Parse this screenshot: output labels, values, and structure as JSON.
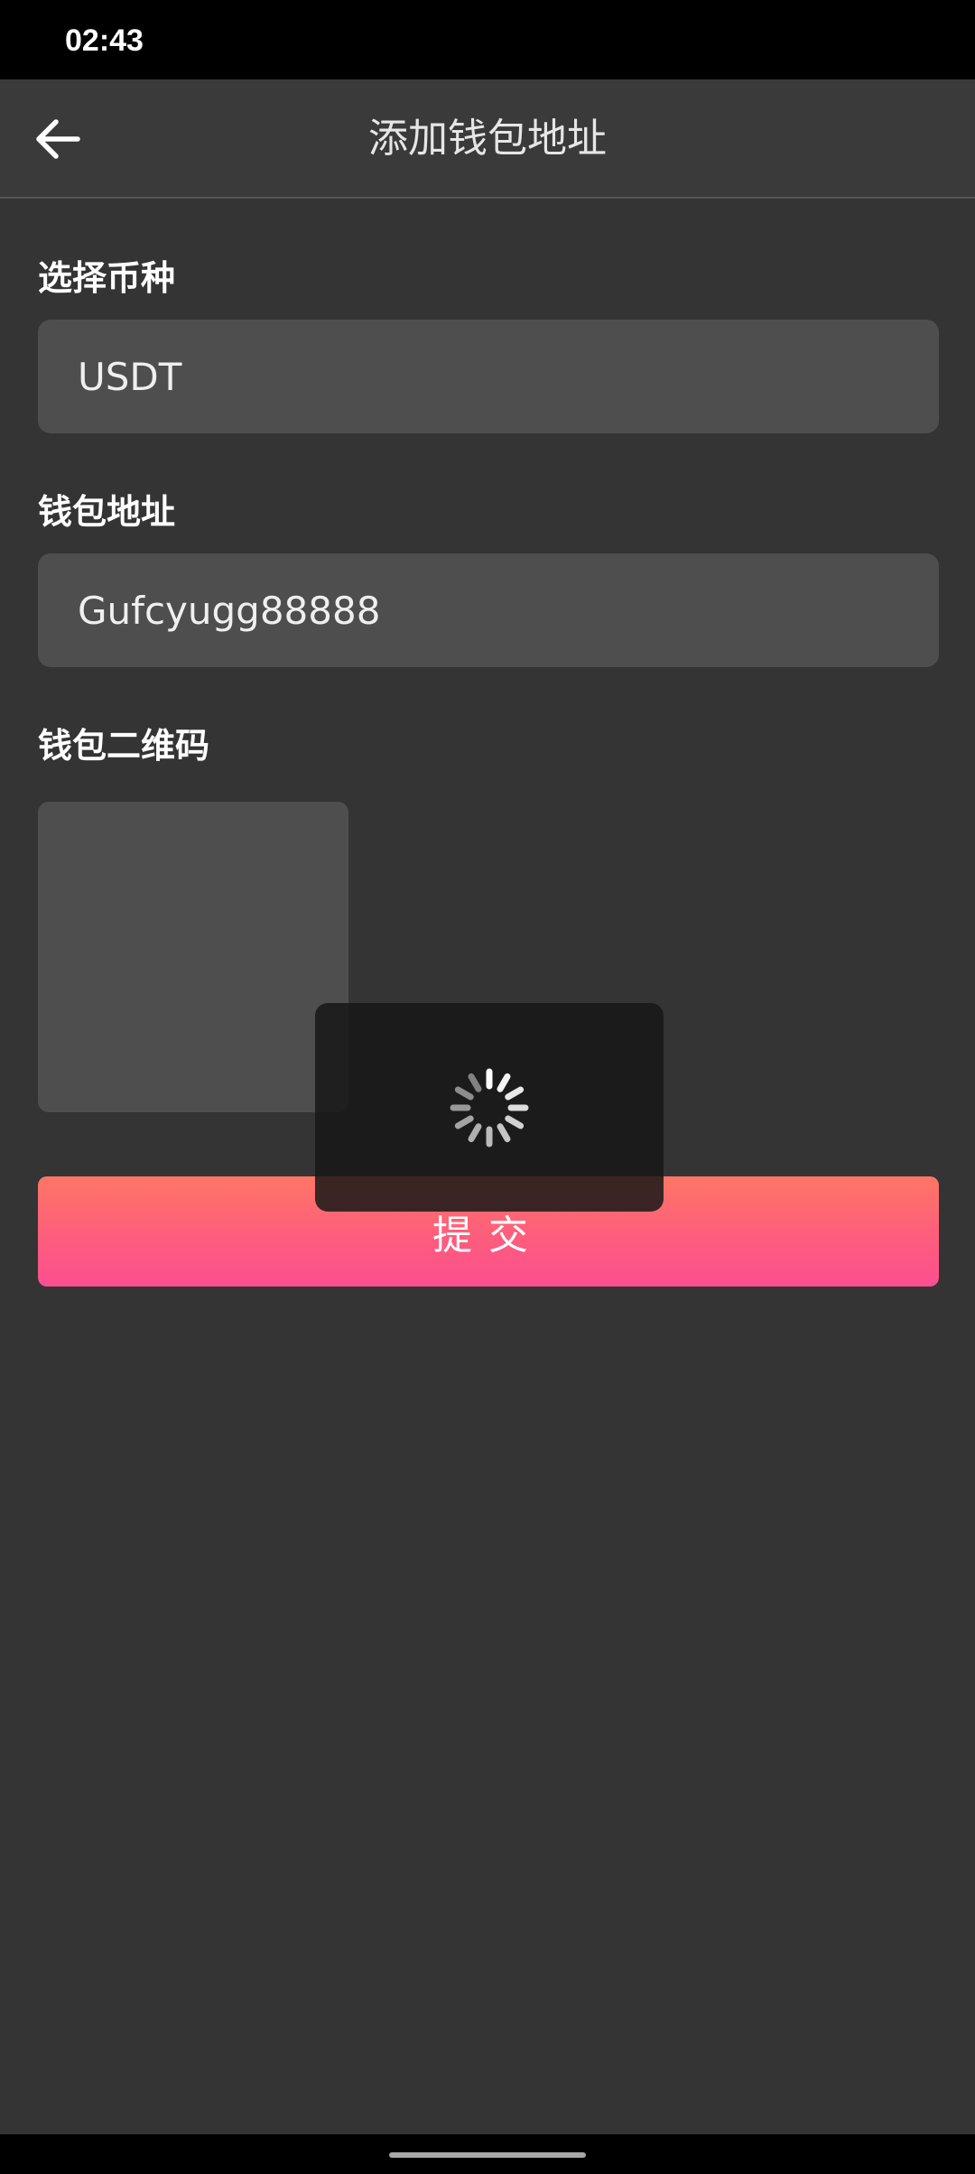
{
  "status_bar": {
    "time": "02:43"
  },
  "app_bar": {
    "title": "添加钱包地址",
    "back_icon": "arrow-left-icon"
  },
  "form": {
    "currency_label": "选择币种",
    "currency_value": "USDT",
    "address_label": "钱包地址",
    "address_value": "Gufcyugg88888",
    "qr_label": "钱包二维码",
    "submit_label": "提交"
  },
  "loading": {
    "icon": "spinner-icon"
  },
  "colors": {
    "background": "#343434",
    "app_bar": "#3a3a3a",
    "field": "#4e4e4e",
    "button_gradient_top": "#ff7665",
    "button_gradient_bottom": "#fc4f91"
  }
}
